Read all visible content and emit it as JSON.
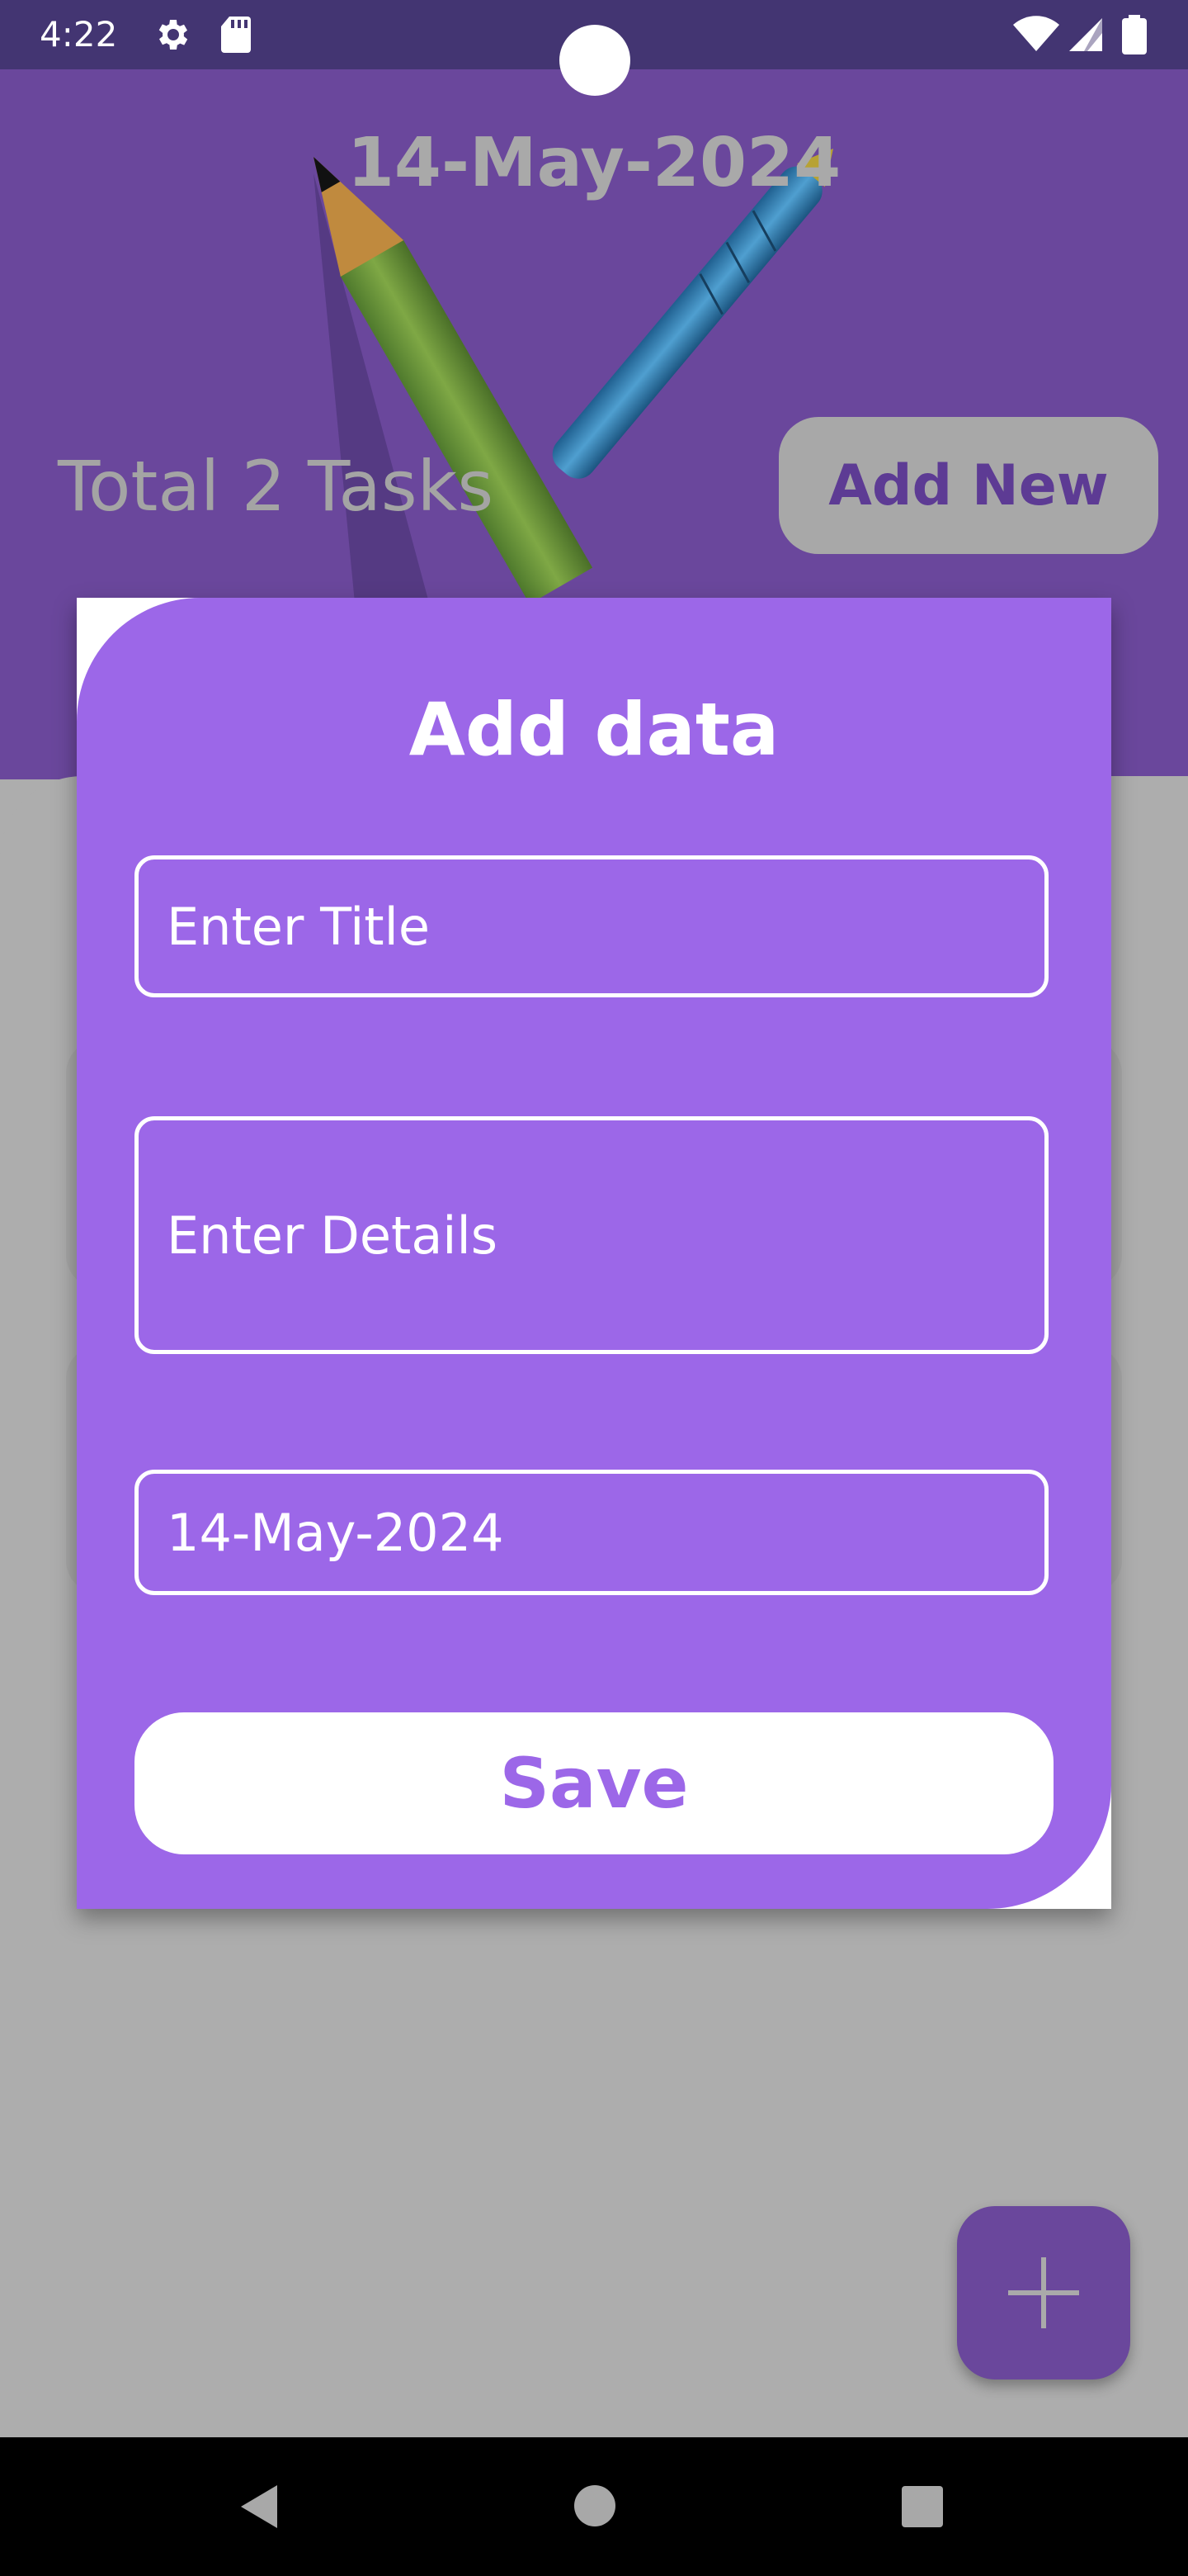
{
  "status_bar": {
    "time": "4:22",
    "icons": [
      "gear-icon",
      "sd-card-icon",
      "wifi-icon",
      "signal-icon",
      "battery-icon"
    ]
  },
  "header": {
    "date": "14-May-2024",
    "total_tasks": "Total 2 Tasks",
    "add_new_label": "Add New",
    "illustration": "pencil-and-pen-illustration"
  },
  "dialog": {
    "title": "Add data",
    "title_placeholder": "Enter Title",
    "details_placeholder": "Enter Details",
    "date_value": "14-May-2024",
    "save_label": "Save"
  },
  "fab": {
    "icon": "plus-icon"
  },
  "nav_bar": {
    "icons": [
      "back-icon",
      "home-icon",
      "recents-icon"
    ]
  },
  "colors": {
    "status_bar": "#433572",
    "header": "#6a479c",
    "dialog": "#9c67e8",
    "scrim": "#adadad"
  }
}
